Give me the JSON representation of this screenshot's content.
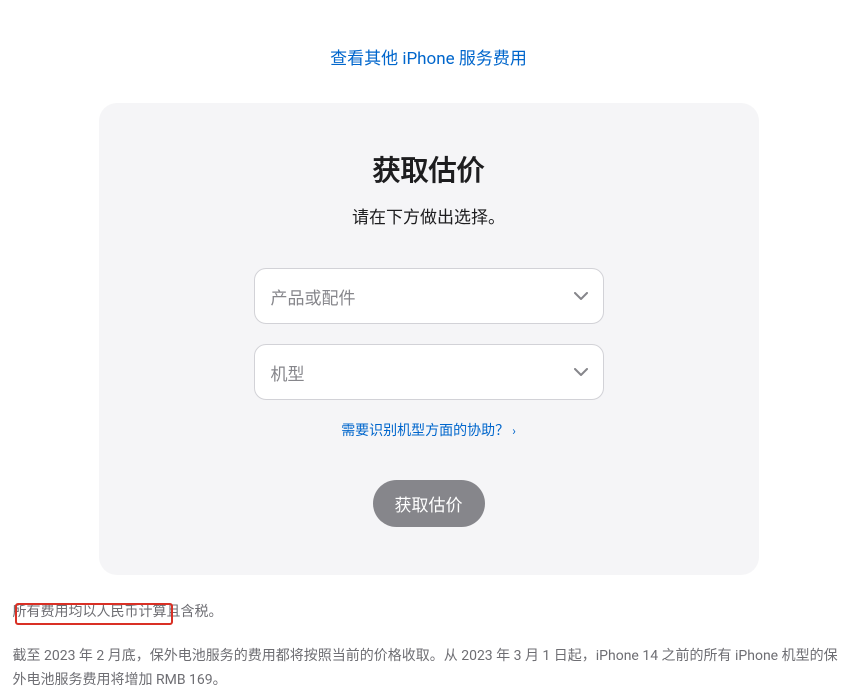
{
  "topLink": {
    "label": "查看其他 iPhone 服务费用"
  },
  "card": {
    "title": "获取估价",
    "subtitle": "请在下方做出选择。",
    "select1": {
      "placeholder": "产品或配件"
    },
    "select2": {
      "placeholder": "机型"
    },
    "helpLink": {
      "label": "需要识别机型方面的协助？"
    },
    "button": {
      "label": "获取估价"
    }
  },
  "footer": {
    "line1": "所有费用均以人民币计算且含税。",
    "line2": "截至 2023 年 2 月底，保外电池服务的费用都将按照当前的价格收取。从 2023 年 3 月 1 日起，iPhone 14 之前的所有 iPhone 机型的保外电池服务费用将增加 RMB 169。"
  }
}
